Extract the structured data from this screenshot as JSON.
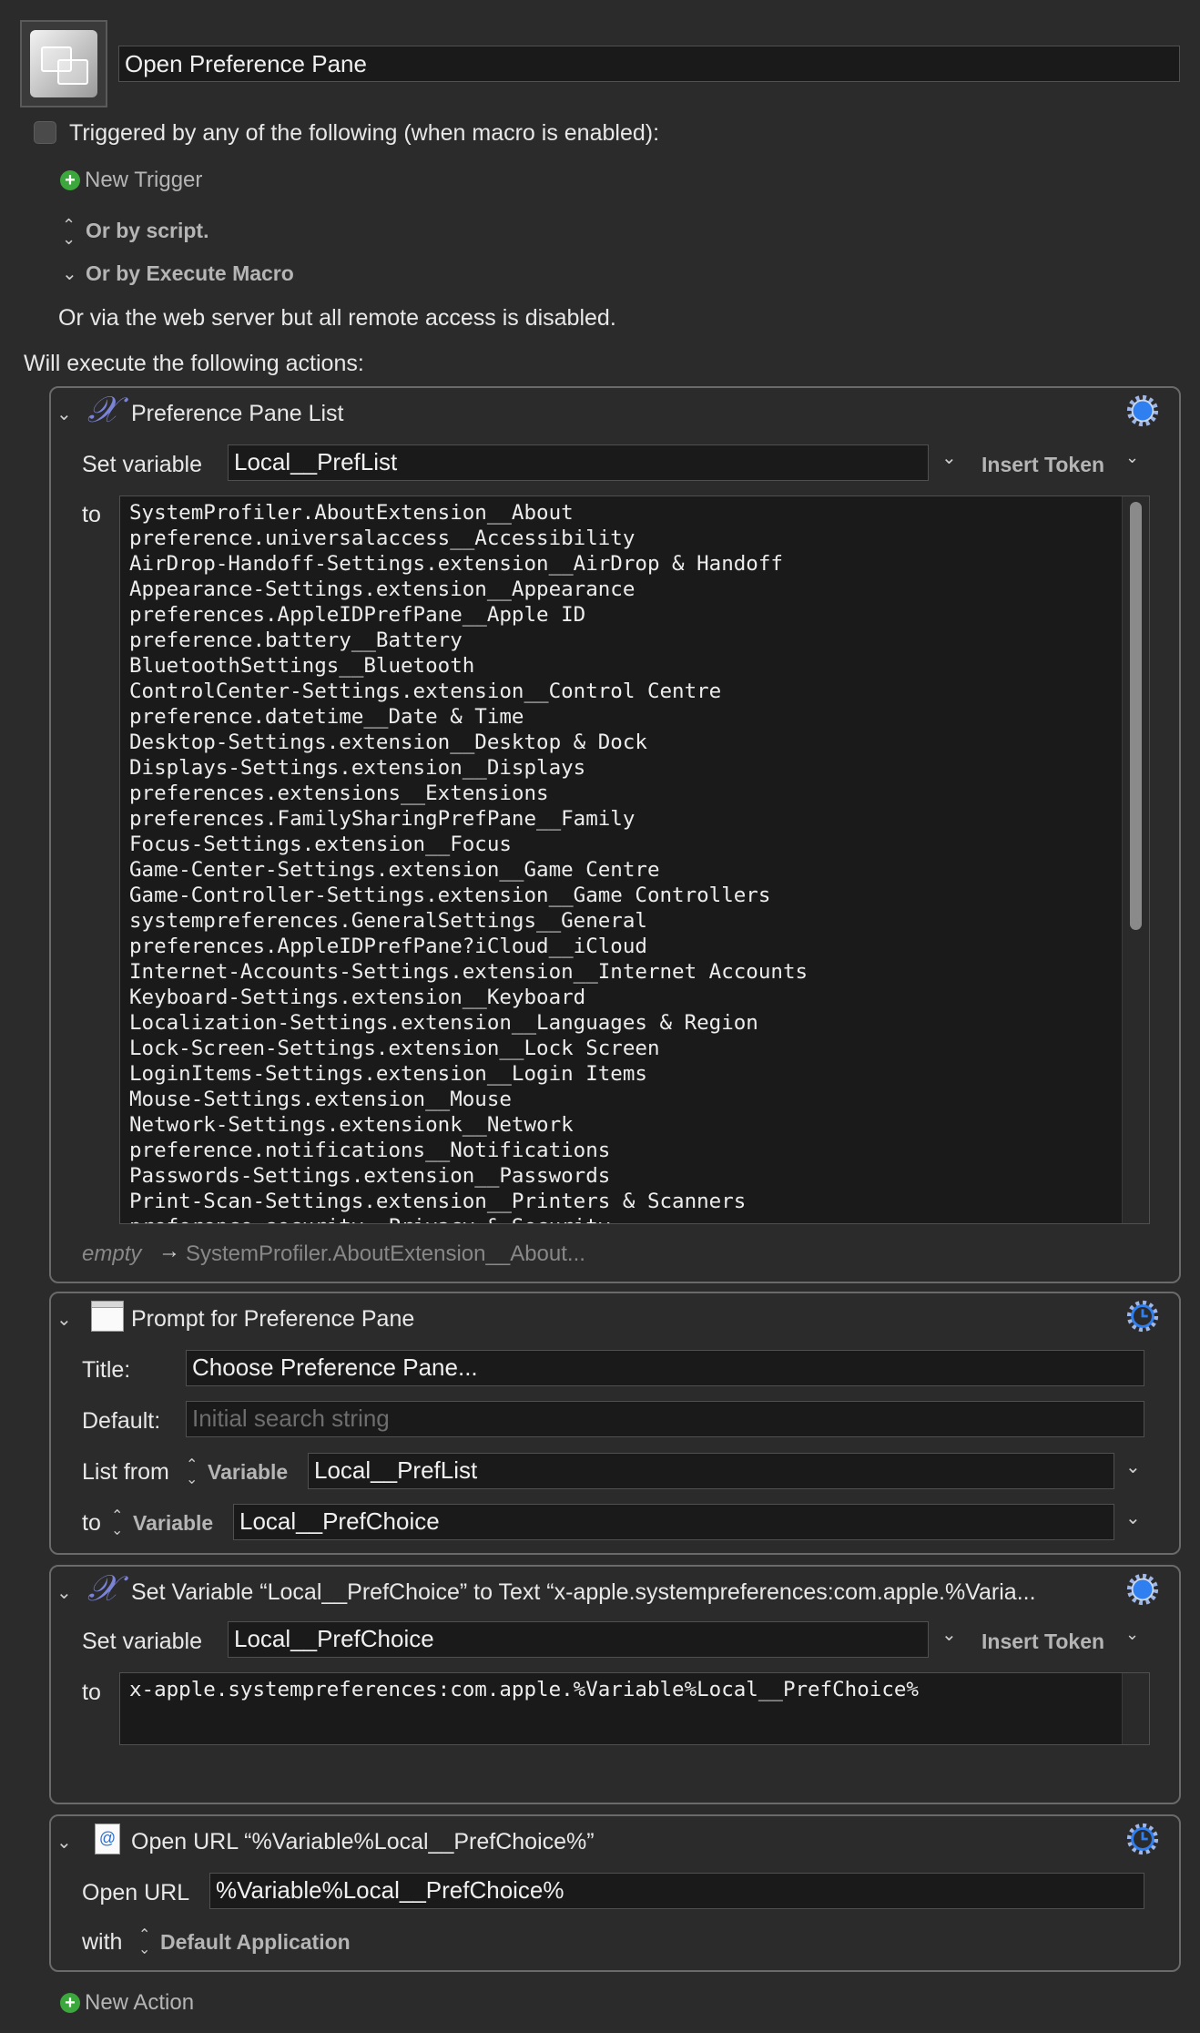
{
  "macro": {
    "name": "Open Preference Pane",
    "trigger_label": "Triggered by any of the following (when macro is enabled):",
    "new_trigger": "New Trigger",
    "or_by_script": "Or by script.",
    "or_by_execute": "Or by Execute Macro",
    "web_server": "Or via the web server but all remote access is disabled.",
    "will_execute": "Will execute the following actions:"
  },
  "action1": {
    "title": "Preference Pane List",
    "set_variable_label": "Set variable",
    "variable": "Local__PrefList",
    "insert_token": "Insert Token",
    "to_label": "to",
    "lines": [
      "SystemProfiler.AboutExtension__About",
      "preference.universalaccess__Accessibility",
      "AirDrop-Handoff-Settings.extension__AirDrop & Handoff",
      "Appearance-Settings.extension__Appearance",
      "preferences.AppleIDPrefPane__Apple ID",
      "preference.battery__Battery",
      "BluetoothSettings__Bluetooth",
      "ControlCenter-Settings.extension__Control Centre",
      "preference.datetime__Date & Time",
      "Desktop-Settings.extension__Desktop & Dock",
      "Displays-Settings.extension__Displays",
      "preferences.extensions__Extensions",
      "preferences.FamilySharingPrefPane__Family",
      "Focus-Settings.extension__Focus",
      "Game-Center-Settings.extension__Game Centre",
      "Game-Controller-Settings.extension__Game Controllers",
      "systempreferences.GeneralSettings__General",
      "preferences.AppleIDPrefPane?iCloud__iCloud",
      "Internet-Accounts-Settings.extension__Internet Accounts",
      "Keyboard-Settings.extension__Keyboard",
      "Localization-Settings.extension__Languages & Region",
      "Lock-Screen-Settings.extension__Lock Screen",
      "LoginItems-Settings.extension__Login Items",
      "Mouse-Settings.extension__Mouse",
      "Network-Settings.extensionk__Network",
      "preference.notifications__Notifications",
      "Passwords-Settings.extension__Passwords",
      "Print-Scan-Settings.extension__Printers & Scanners",
      "preference.security__Privacy & Security"
    ],
    "footer_empty": "empty",
    "footer_value": "SystemProfiler.AboutExtension__About..."
  },
  "action2": {
    "title": "Prompt for Preference Pane",
    "title_label": "Title:",
    "title_value": "Choose Preference Pane...",
    "default_label": "Default:",
    "default_placeholder": "Initial search string",
    "list_from_label": "List from",
    "variable_word": "Variable",
    "list_variable": "Local__PrefList",
    "to_label": "to",
    "to_variable": "Local__PrefChoice"
  },
  "action3": {
    "title": "Set Variable “Local__PrefChoice” to Text “x-apple.systempreferences:com.apple.%Varia...",
    "set_variable_label": "Set variable",
    "variable": "Local__PrefChoice",
    "insert_token": "Insert Token",
    "to_label": "to",
    "text": "x-apple.systempreferences:com.apple.%Variable%Local__PrefChoice%"
  },
  "action4": {
    "title": "Open URL “%Variable%Local__PrefChoice%”",
    "open_url_label": "Open URL",
    "url": "%Variable%Local__PrefChoice%",
    "with_label": "with",
    "application": "Default Application"
  },
  "new_action": "New Action",
  "colors": {
    "background": "#2b2b2b",
    "field": "#1a1a1a",
    "accent_blue": "#2f7ff0",
    "variable_x": "#7b83d6",
    "add_green": "#3ca73c"
  }
}
